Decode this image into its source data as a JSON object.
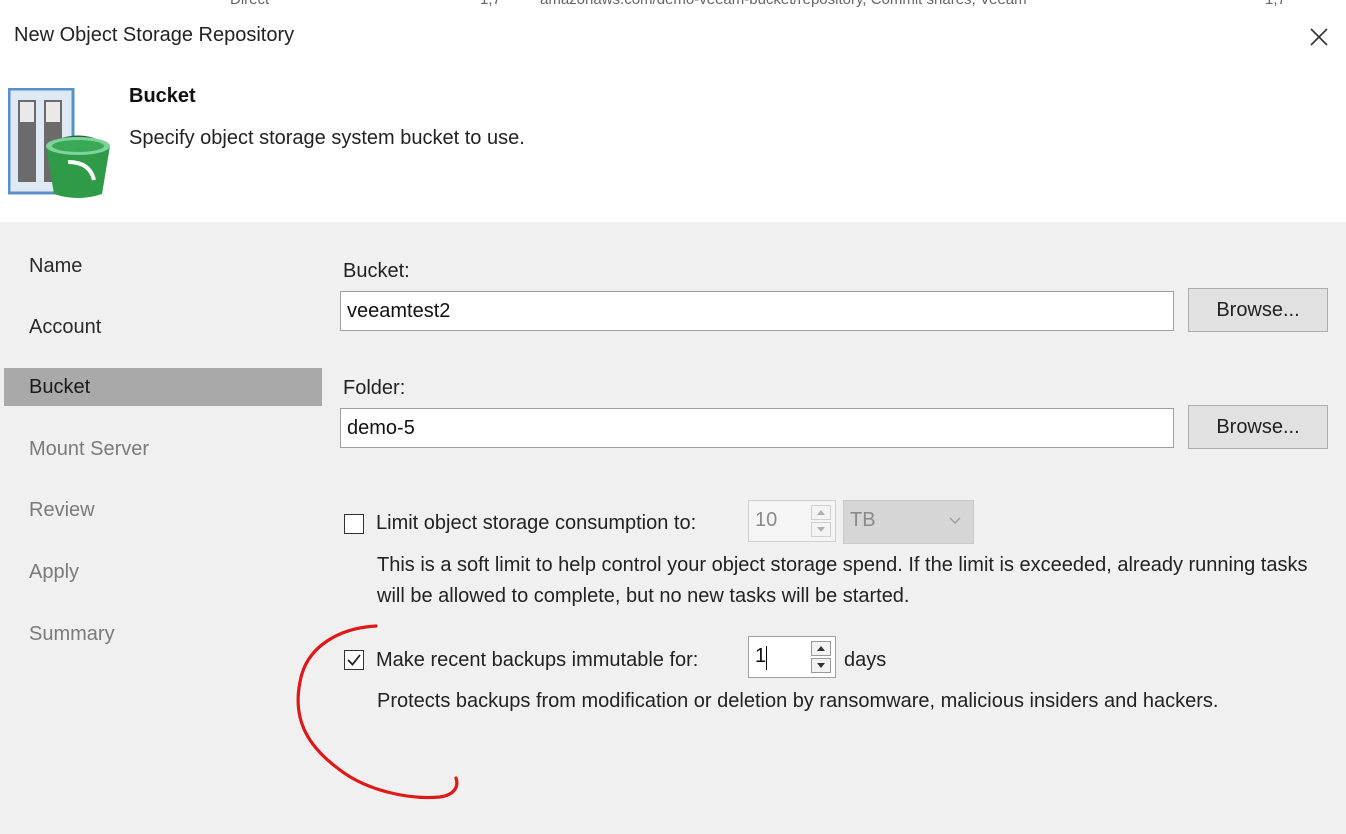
{
  "background_window": {
    "row_text": [
      "Direct",
      "1,7",
      "amazonaws.com/demo-veeam-bucket/repository, Commit shares, Veeam",
      "1,7"
    ]
  },
  "dialog": {
    "title": "New Object Storage Repository",
    "close_label": "✕"
  },
  "header": {
    "title": "Bucket",
    "description": "Specify object storage system bucket to use."
  },
  "nav": {
    "items": [
      {
        "label": "Name",
        "state": "done"
      },
      {
        "label": "Account",
        "state": "done"
      },
      {
        "label": "Bucket",
        "state": "active"
      },
      {
        "label": "Mount Server",
        "state": "pending"
      },
      {
        "label": "Review",
        "state": "pending"
      },
      {
        "label": "Apply",
        "state": "pending"
      },
      {
        "label": "Summary",
        "state": "pending"
      }
    ]
  },
  "form": {
    "bucket": {
      "label": "Bucket:",
      "value": "veeamtest2",
      "browse_label": "Browse..."
    },
    "folder": {
      "label": "Folder:",
      "value": "demo-5",
      "browse_label": "Browse..."
    },
    "limit": {
      "checked": false,
      "label": "Limit object storage consumption to:",
      "value": "10",
      "unit": "TB",
      "help": "This is a soft limit to help control your object storage spend. If the limit is exceeded, already running tasks will be allowed to complete, but no new tasks will be started."
    },
    "immutable": {
      "checked": true,
      "label": "Make recent backups immutable for:",
      "value": "1",
      "unit": "days",
      "help": "Protects backups from modification or deletion by ransomware, malicious insiders and hackers."
    }
  },
  "annotation": {
    "color": "#e01818"
  },
  "colors": {
    "panel_bg": "#f0f0f0",
    "nav_active_bg": "#a9a9a9",
    "bucket_green": "#2f9a48"
  }
}
